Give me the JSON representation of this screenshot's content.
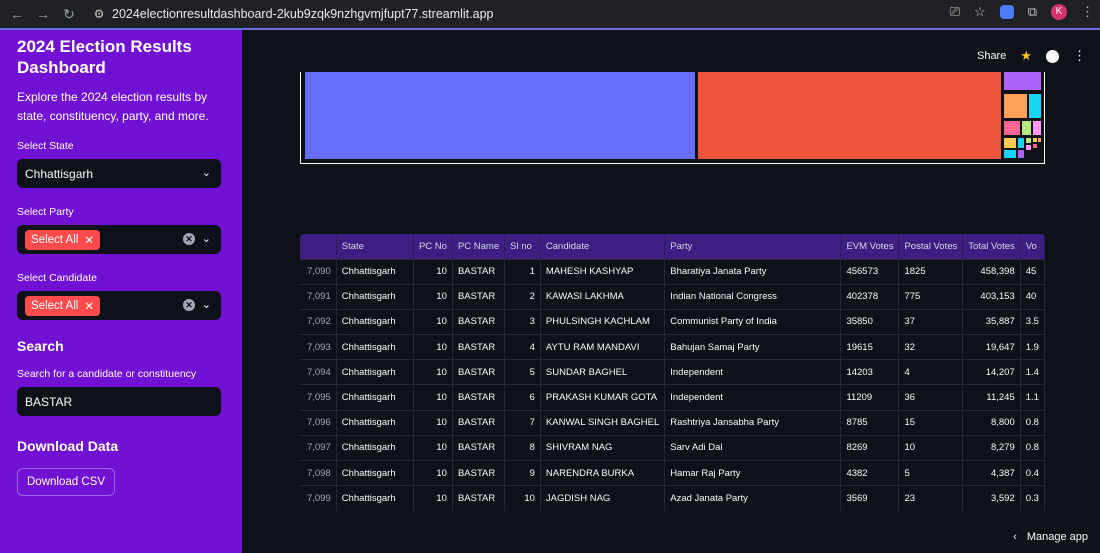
{
  "browser": {
    "url": "2024electionresultdashboard-2kub9zqk9nzhgvmjfupt77.streamlit.app",
    "avatar_letter": "K"
  },
  "sidebar": {
    "title": "2024 Election Results Dashboard",
    "description": "Explore the 2024 election results by state, constituency, party, and more.",
    "state_label": "Select State",
    "state_value": "Chhattisgarh",
    "party_label": "Select Party",
    "party_tag": "Select All",
    "candidate_label": "Select Candidate",
    "candidate_tag": "Select All",
    "search_heading": "Search",
    "search_label": "Search for a candidate or constituency",
    "search_value": "BASTAR",
    "download_heading": "Download Data",
    "download_button": "Download CSV"
  },
  "topbar": {
    "share": "Share"
  },
  "treemap_colors": [
    "#636efa",
    "#ef553b",
    "#ab63fa",
    "#ffa15a",
    "#19d3f3",
    "#ff6692",
    "#b6e880",
    "#ff97ff",
    "#fecb52"
  ],
  "table": {
    "columns": [
      "",
      "State",
      "PC No",
      "PC Name",
      "Sl no",
      "Candidate",
      "Party",
      "EVM Votes",
      "Postal Votes",
      "Total Votes",
      "Vo"
    ],
    "rows": [
      [
        "7,090",
        "Chhattisgarh",
        "10",
        "BASTAR",
        "1",
        "MAHESH KASHYAP",
        "Bharatiya Janata Party",
        "456573",
        "1825",
        "458,398",
        "45"
      ],
      [
        "7,091",
        "Chhattisgarh",
        "10",
        "BASTAR",
        "2",
        "KAWASI LAKHMA",
        "Indian National Congress",
        "402378",
        "775",
        "403,153",
        "40"
      ],
      [
        "7,092",
        "Chhattisgarh",
        "10",
        "BASTAR",
        "3",
        "PHULSINGH KACHLAM",
        "Communist Party of India",
        "35850",
        "37",
        "35,887",
        "3.5"
      ],
      [
        "7,093",
        "Chhattisgarh",
        "10",
        "BASTAR",
        "4",
        "AYTU RAM MANDAVI",
        "Bahujan Samaj Party",
        "19615",
        "32",
        "19,647",
        "1.9"
      ],
      [
        "7,094",
        "Chhattisgarh",
        "10",
        "BASTAR",
        "5",
        "SUNDAR BAGHEL",
        "Independent",
        "14203",
        "4",
        "14,207",
        "1.4"
      ],
      [
        "7,095",
        "Chhattisgarh",
        "10",
        "BASTAR",
        "6",
        "PRAKASH KUMAR GOTA",
        "Independent",
        "11209",
        "36",
        "11,245",
        "1.1"
      ],
      [
        "7,096",
        "Chhattisgarh",
        "10",
        "BASTAR",
        "7",
        "KANWAL SINGH BAGHEL",
        "Rashtriya Jansabha Party",
        "8785",
        "15",
        "8,800",
        "0.8"
      ],
      [
        "7,097",
        "Chhattisgarh",
        "10",
        "BASTAR",
        "8",
        "SHIVRAM NAG",
        "Sarv Adi Dal",
        "8269",
        "10",
        "8,279",
        "0.8"
      ],
      [
        "7,098",
        "Chhattisgarh",
        "10",
        "BASTAR",
        "9",
        "NARENDRA BURKA",
        "Hamar Raj Party",
        "4382",
        "5",
        "4,387",
        "0.4"
      ],
      [
        "7,099",
        "Chhattisgarh",
        "10",
        "BASTAR",
        "10",
        "JAGDISH NAG",
        "Azad Janata Party",
        "3569",
        "23",
        "3,592",
        "0.3"
      ]
    ]
  },
  "manage_app": "Manage app"
}
